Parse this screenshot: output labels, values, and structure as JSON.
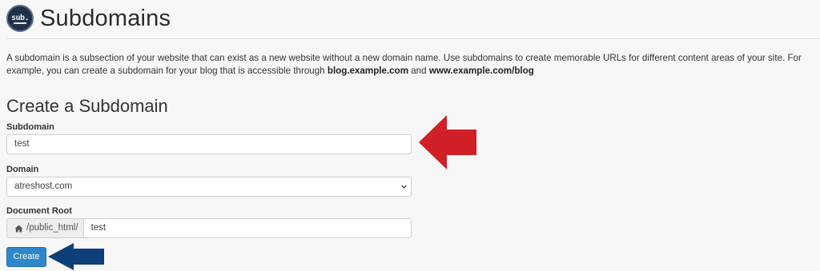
{
  "header": {
    "logo_text": "sub.",
    "title": "Subdomains"
  },
  "description": {
    "text_before": "A subdomain is a subsection of your website that can exist as a new website without a new domain name. Use subdomains to create memorable URLs for different content areas of your site. For example, you can create a subdomain for your blog that is accessible through ",
    "example_subdomain": "blog.example.com",
    "connector": " and ",
    "example_path": "www.example.com/blog"
  },
  "form": {
    "section_title": "Create a Subdomain",
    "subdomain": {
      "label": "Subdomain",
      "value": "test"
    },
    "domain": {
      "label": "Domain",
      "selected": "atreshost.com"
    },
    "document_root": {
      "label": "Document Root",
      "prefix": "/public_html/",
      "prefix_icon": "home-icon",
      "value": "test"
    },
    "submit_label": "Create"
  },
  "annotations": {
    "red_arrow_color": "#d11f27",
    "blue_arrow_color": "#0d3f78"
  }
}
